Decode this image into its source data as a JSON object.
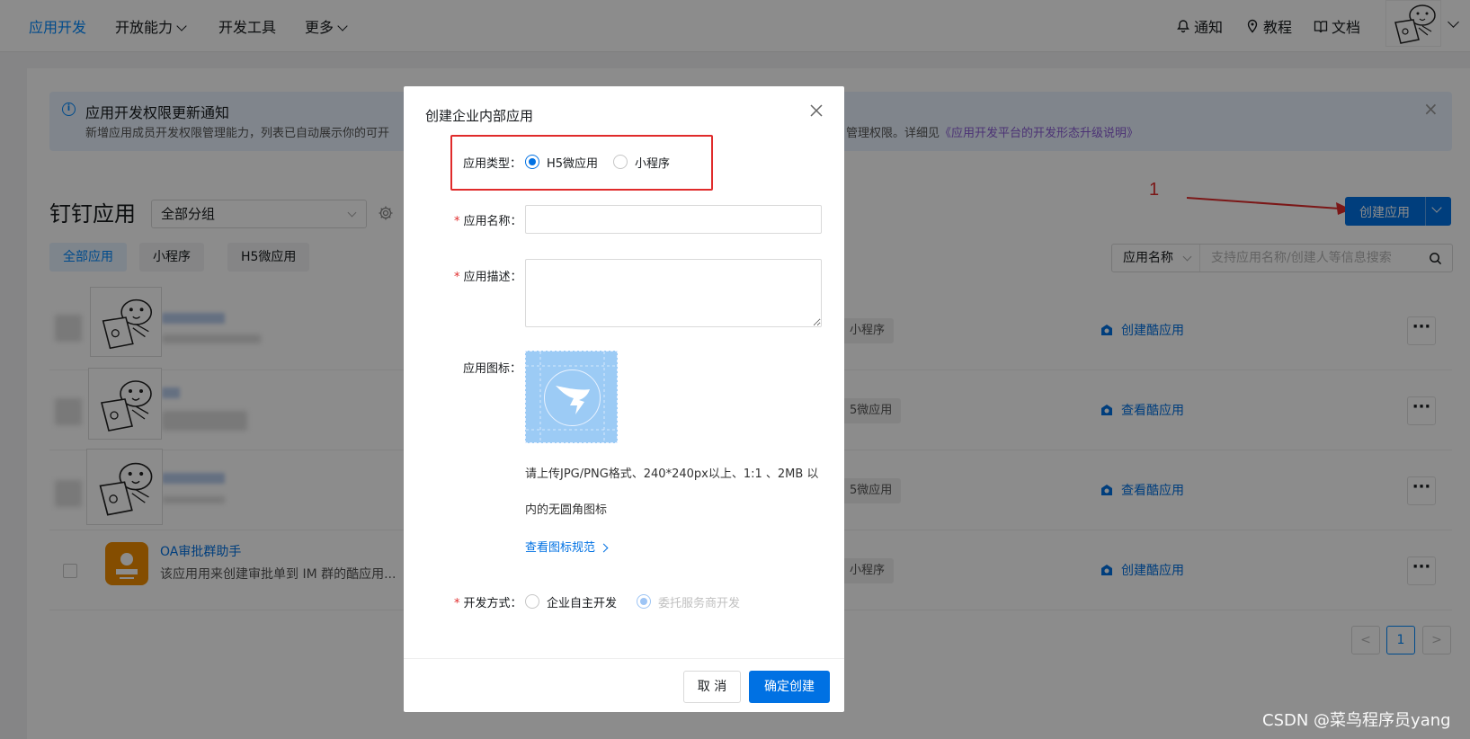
{
  "nav": {
    "items": [
      "应用开发",
      "开放能力",
      "开发工具",
      "更多"
    ],
    "notify": "通知",
    "tutorial": "教程",
    "docs": "文档"
  },
  "notice": {
    "title": "应用开发权限更新通知",
    "text_left": "新增应用成员开发权限管理能力，列表已自动展示你的可开",
    "text_right": "管理权限。详细见",
    "link": "《应用开发平台的开发形态升级说明》"
  },
  "page": {
    "title": "钉钉应用",
    "group_select": "全部分组",
    "tabs": [
      "全部应用",
      "小程序",
      "H5微应用"
    ],
    "create_button": "创建应用",
    "annotation_number": "1",
    "search_type": "应用名称",
    "search_placeholder": "支持应用名称/创建人等信息搜索"
  },
  "rows": [
    {
      "tag": "小程序",
      "action": "创建酷应用"
    },
    {
      "tag": "5微应用",
      "action": "查看酷应用"
    },
    {
      "tag": "5微应用",
      "action": "查看酷应用"
    },
    {
      "title": "OA审批群助手",
      "desc": "该应用用来创建审批单到 IM 群的酷应用...",
      "tag": "小程序",
      "action": "创建酷应用"
    }
  ],
  "pagination": {
    "prev": "<",
    "current": "1",
    "next": ">"
  },
  "modal": {
    "title": "创建企业内部应用",
    "type_label": "应用类型：",
    "type_options": [
      "H5微应用",
      "小程序"
    ],
    "type_selected": "H5微应用",
    "name_label": "应用名称：",
    "desc_label": "应用描述：",
    "icon_label": "应用图标：",
    "hint_line1": "请上传JPG/PNG格式、240*240px以上、1:1 、2MB 以",
    "hint_line2": "内的无圆角图标",
    "hint_link": "查看图标规范",
    "dev_label": "开发方式：",
    "dev_options": [
      "企业自主开发",
      "委托服务商开发"
    ],
    "dev_selected": "委托服务商开发",
    "cancel": "取 消",
    "confirm": "确定创建"
  },
  "watermark": "CSDN @菜鸟程序员yang",
  "colors": {
    "primary": "#0071e3",
    "accent": "#0089ff",
    "annotation": "#e02b2b",
    "orange_icon": "#f08c00"
  }
}
